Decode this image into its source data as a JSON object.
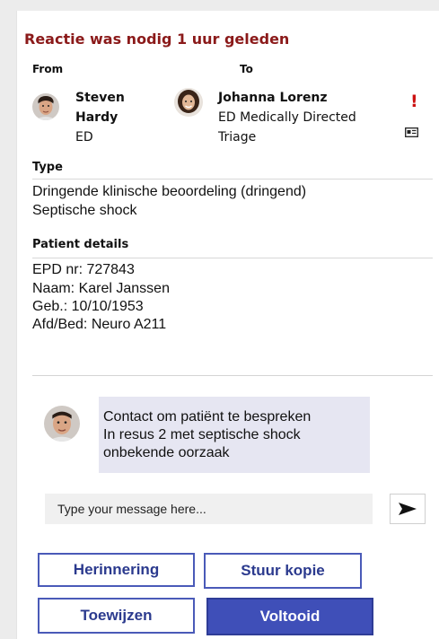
{
  "header": {
    "title": "Reactie was nodig 1 uur geleden"
  },
  "from": {
    "label": "From",
    "name_line1": "Steven",
    "name_line2": "Hardy",
    "department": "ED",
    "avatar_icon": "person-avatar-icon"
  },
  "to": {
    "label": "To",
    "name": "Johanna Lorenz",
    "role_line1": "ED Medically Directed",
    "role_line2": "Triage",
    "avatar_icon": "person-avatar-icon"
  },
  "indicators": {
    "urgent": "!",
    "urgent_color": "#cc1111",
    "card_icon": "id-card-icon"
  },
  "type": {
    "title": "Type",
    "lines": [
      "Dringende klinische beoordeling (dringend)",
      "Septische shock"
    ]
  },
  "patient": {
    "title": "Patient details",
    "lines": [
      "EPD nr: 727843",
      "Naam: Karel Janssen",
      "Geb.: 10/10/1953",
      "Afd/Bed: Neuro A211"
    ]
  },
  "message": {
    "lines": [
      "Contact om patiënt te bespreken",
      "In resus 2 met septische shock",
      "onbekende oorzaak"
    ]
  },
  "composer": {
    "placeholder": "Type your message here...",
    "send_icon": "send-arrow-icon"
  },
  "actions": {
    "remind": "Herinnering",
    "copy": "Stuur kopie",
    "assign": "Toewijzen",
    "complete": "Voltooid"
  },
  "colors": {
    "header": "#8b1a1a",
    "accent": "#3f4fb8",
    "bubble": "#e6e6f2"
  }
}
